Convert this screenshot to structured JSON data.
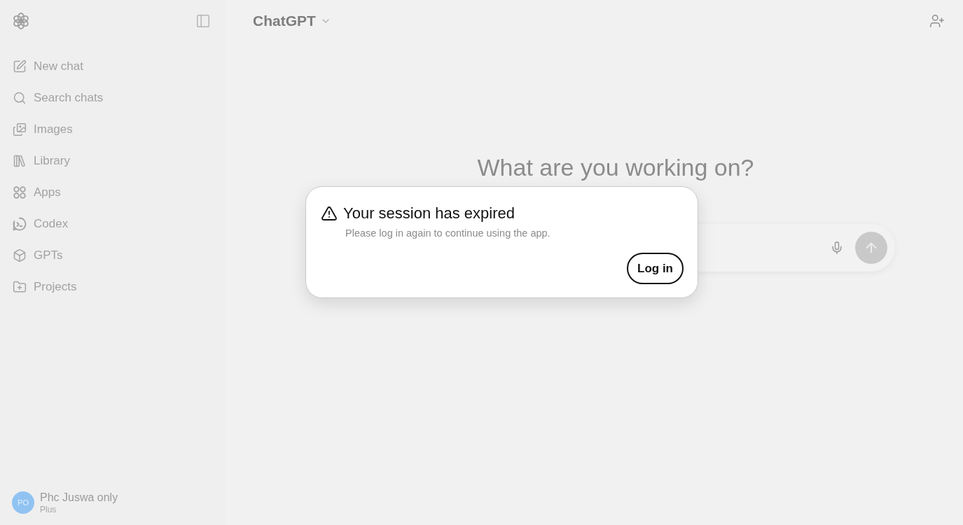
{
  "sidebar": {
    "items": [
      "New chat",
      "Search chats",
      "Images",
      "Library",
      "Apps",
      "Codex",
      "GPTs",
      "Projects"
    ],
    "account": {
      "initials": "PO",
      "name": "Phc Juswa only",
      "plan": "Plus"
    }
  },
  "header": {
    "model": "ChatGPT"
  },
  "main": {
    "heading": "What are you working on?"
  },
  "dialog": {
    "title": "Your session has expired",
    "message": "Please log in again to continue using the app.",
    "button": "Log in"
  }
}
